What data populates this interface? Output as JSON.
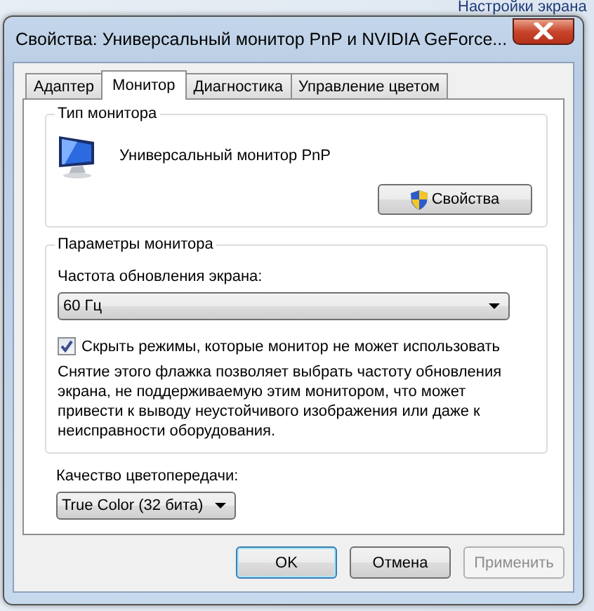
{
  "background_window": {
    "title": "Настройки экрана"
  },
  "window": {
    "title": "Свойства: Универсальный монитор PnP и NVIDIA GeForce..."
  },
  "tabs": [
    {
      "label": "Адаптер",
      "selected": false
    },
    {
      "label": "Монитор",
      "selected": true
    },
    {
      "label": "Диагностика",
      "selected": false
    },
    {
      "label": "Управление цветом",
      "selected": false
    }
  ],
  "monitor_type": {
    "heading": "Тип монитора",
    "name": "Универсальный монитор PnP",
    "properties_button": "Свойства"
  },
  "monitor_settings": {
    "heading": "Параметры монитора",
    "refresh_label": "Частота обновления экрана:",
    "refresh_value": "60 Гц",
    "hide_modes": {
      "label": "Скрыть режимы, которые монитор не может использовать",
      "checked": true
    },
    "warning": "Снятие этого флажка позволяет выбрать частоту обновления экрана, не поддерживаемую этим монитором, что может привести к выводу неустойчивого изображения или даже к неисправности оборудования."
  },
  "color_quality": {
    "label": "Качество цветопередачи:",
    "value": "True Color (32 бита)"
  },
  "buttons": [
    {
      "label": "OK",
      "kind": "default",
      "disabled": false
    },
    {
      "label": "Отмена",
      "kind": "normal",
      "disabled": false
    },
    {
      "label": "Применить",
      "kind": "normal",
      "disabled": true
    }
  ]
}
